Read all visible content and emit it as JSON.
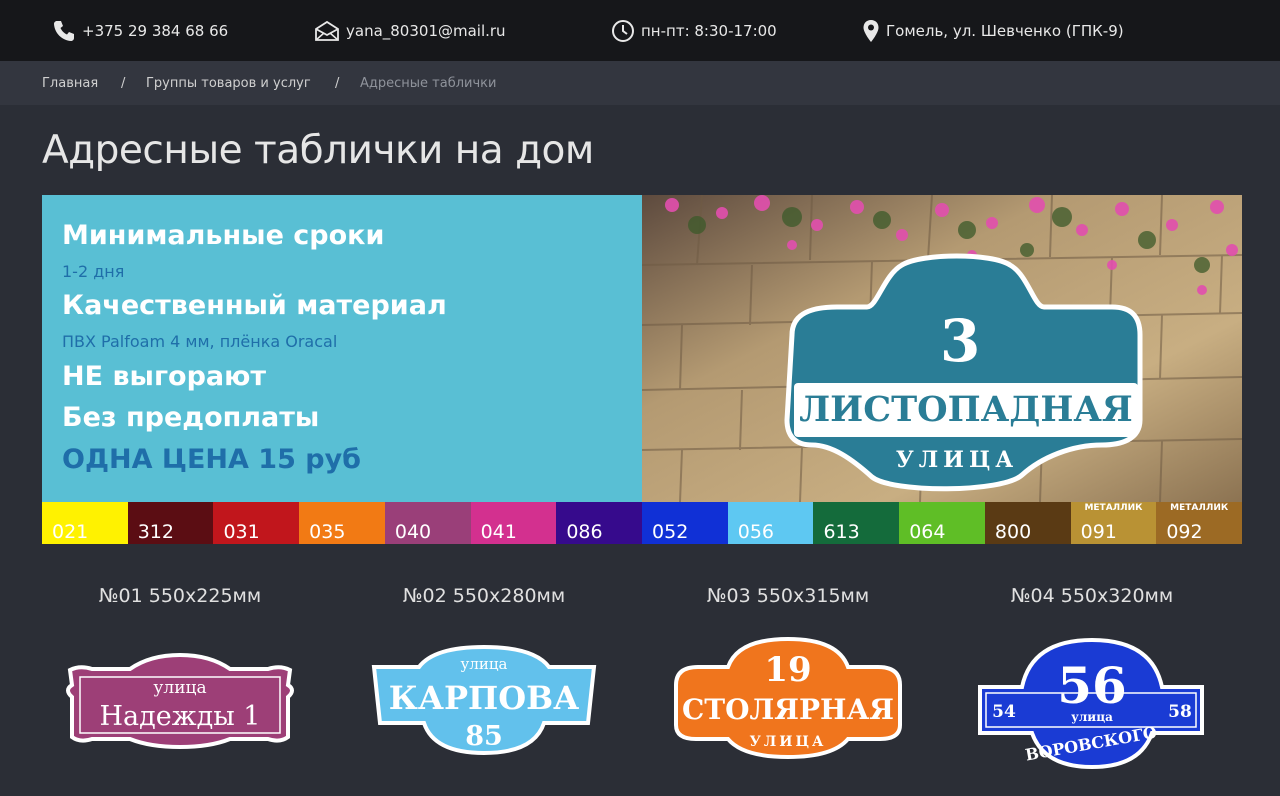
{
  "topbar": {
    "phone": "+375 29 384 68 66",
    "email": "yana_80301@mail.ru",
    "hours": "пн-пт: 8:30-17:00",
    "address": "Гомель, ул. Шевченко (ГПК-9)"
  },
  "breadcrumb": {
    "home": "Главная",
    "sep1": "/",
    "group": "Группы товаров и услуг",
    "sep2": "/",
    "current": "Адресные таблички"
  },
  "page_title": "Адресные таблички на дом",
  "promo": {
    "h1": "Минимальные сроки",
    "s1": "1-2 дня",
    "h2": "Качественный материал",
    "s2": "ПВХ Palfoam 4 мм, плёнка Oracal",
    "h3": "НЕ выгорают",
    "h4": "Без предоплаты",
    "price": "ОДНА ЦЕНА 15 руб"
  },
  "banner_sign": {
    "number": "3",
    "street": "ЛИСТОПАДНАЯ",
    "word": "УЛИЦА"
  },
  "swatches": [
    {
      "code": "021",
      "color": "#fff200"
    },
    {
      "code": "312",
      "color": "#5b0d13"
    },
    {
      "code": "031",
      "color": "#c1161c"
    },
    {
      "code": "035",
      "color": "#f27a14"
    },
    {
      "code": "040",
      "color": "#9a3f79"
    },
    {
      "code": "041",
      "color": "#d3308f"
    },
    {
      "code": "086",
      "color": "#360a8c"
    },
    {
      "code": "052",
      "color": "#1030d6"
    },
    {
      "code": "056",
      "color": "#5ec8f2"
    },
    {
      "code": "613",
      "color": "#146b3b"
    },
    {
      "code": "064",
      "color": "#5fbe26"
    },
    {
      "code": "800",
      "color": "#5a3a14"
    },
    {
      "code": "091",
      "color": "#b99234",
      "tag": "МЕТАЛЛИК"
    },
    {
      "code": "092",
      "color": "#9c6a24",
      "tag": "МЕТАЛЛИК"
    }
  ],
  "products": [
    {
      "caption": "№01 550х225мм",
      "word": "улица",
      "street": "Надежды 1"
    },
    {
      "caption": "№02 550х280мм",
      "word": "улица",
      "street": "КАРПОВА",
      "number": "85"
    },
    {
      "caption": "№03 550х315мм",
      "word": "УЛИЦА",
      "street": "СТОЛЯРНАЯ",
      "number": "19"
    },
    {
      "caption": "№04 550х320мм",
      "word": "улица",
      "street": "ВОРОВСКОГО",
      "number": "56",
      "left": "54",
      "right": "58"
    }
  ]
}
